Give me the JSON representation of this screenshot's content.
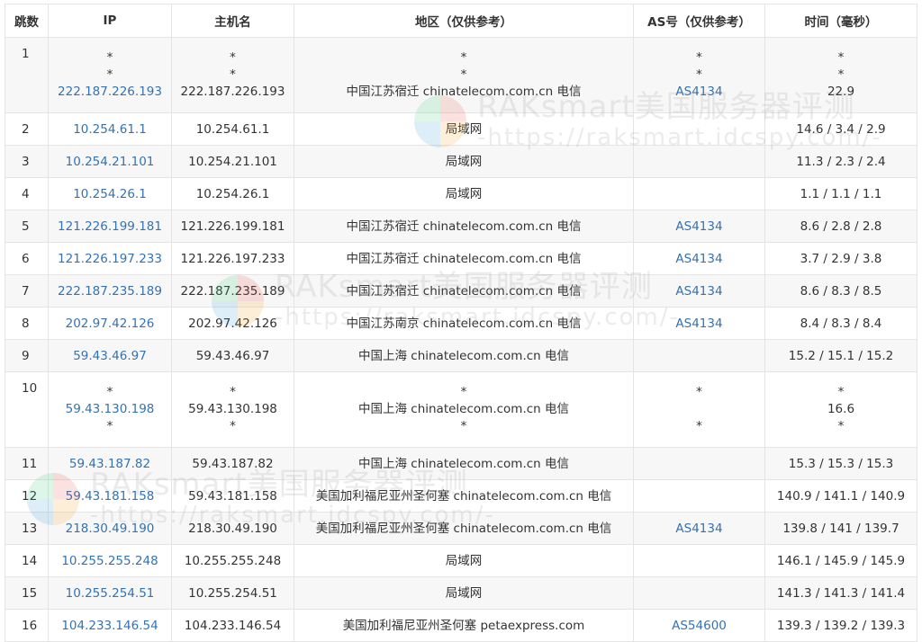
{
  "headers": [
    "跳数",
    "IP",
    "主机名",
    "地区（仅供参考）",
    "AS号（仅供参考）",
    "时间（毫秒）"
  ],
  "rows": [
    {
      "hop": "1",
      "ip": [
        "*",
        "*",
        "222.187.226.193"
      ],
      "host": [
        "*",
        "*",
        "222.187.226.193"
      ],
      "region": [
        "*",
        "*",
        "中国江苏宿迁 chinatelecom.com.cn 电信"
      ],
      "as": [
        "*",
        "*",
        "AS4134"
      ],
      "time": [
        "*",
        "*",
        "22.9"
      ]
    },
    {
      "hop": "2",
      "ip": [
        "10.254.61.1"
      ],
      "host": [
        "10.254.61.1"
      ],
      "region": [
        "局域网"
      ],
      "as": [
        ""
      ],
      "time": [
        "14.6 / 3.4 / 2.9"
      ]
    },
    {
      "hop": "3",
      "ip": [
        "10.254.21.101"
      ],
      "host": [
        "10.254.21.101"
      ],
      "region": [
        "局域网"
      ],
      "as": [
        ""
      ],
      "time": [
        "11.3 / 2.3 / 2.4"
      ]
    },
    {
      "hop": "4",
      "ip": [
        "10.254.26.1"
      ],
      "host": [
        "10.254.26.1"
      ],
      "region": [
        "局域网"
      ],
      "as": [
        ""
      ],
      "time": [
        "1.1 / 1.1 / 1.1"
      ]
    },
    {
      "hop": "5",
      "ip": [
        "121.226.199.181"
      ],
      "host": [
        "121.226.199.181"
      ],
      "region": [
        "中国江苏宿迁 chinatelecom.com.cn 电信"
      ],
      "as": [
        "AS4134"
      ],
      "time": [
        "8.6 / 2.8 / 2.8"
      ]
    },
    {
      "hop": "6",
      "ip": [
        "121.226.197.233"
      ],
      "host": [
        "121.226.197.233"
      ],
      "region": [
        "中国江苏宿迁 chinatelecom.com.cn 电信"
      ],
      "as": [
        "AS4134"
      ],
      "time": [
        "3.7 / 2.9 / 3.8"
      ]
    },
    {
      "hop": "7",
      "ip": [
        "222.187.235.189"
      ],
      "host": [
        "222.187.235.189"
      ],
      "region": [
        "中国江苏宿迁 chinatelecom.com.cn 电信"
      ],
      "as": [
        "AS4134"
      ],
      "time": [
        "8.6 / 8.3 / 8.5"
      ]
    },
    {
      "hop": "8",
      "ip": [
        "202.97.42.126"
      ],
      "host": [
        "202.97.42.126"
      ],
      "region": [
        "中国江苏南京 chinatelecom.com.cn 电信"
      ],
      "as": [
        "AS4134"
      ],
      "time": [
        "8.4 / 8.3 / 8.4"
      ]
    },
    {
      "hop": "9",
      "ip": [
        "59.43.46.97"
      ],
      "host": [
        "59.43.46.97"
      ],
      "region": [
        "中国上海 chinatelecom.com.cn 电信"
      ],
      "as": [
        ""
      ],
      "time": [
        "15.2 / 15.1 / 15.2"
      ]
    },
    {
      "hop": "10",
      "ip": [
        "*",
        "59.43.130.198",
        "*"
      ],
      "host": [
        "*",
        "59.43.130.198",
        "*"
      ],
      "region": [
        "*",
        "中国上海 chinatelecom.com.cn 电信",
        "*"
      ],
      "as": [
        "*",
        "",
        "*"
      ],
      "time": [
        "*",
        "16.6",
        "*"
      ]
    },
    {
      "hop": "11",
      "ip": [
        "59.43.187.82"
      ],
      "host": [
        "59.43.187.82"
      ],
      "region": [
        "中国上海 chinatelecom.com.cn 电信"
      ],
      "as": [
        ""
      ],
      "time": [
        "15.3 / 15.3 / 15.3"
      ]
    },
    {
      "hop": "12",
      "ip": [
        "59.43.181.158"
      ],
      "host": [
        "59.43.181.158"
      ],
      "region": [
        "美国加利福尼亚州圣何塞 chinatelecom.com.cn 电信"
      ],
      "as": [
        ""
      ],
      "time": [
        "140.9 / 141.1 / 140.9"
      ]
    },
    {
      "hop": "13",
      "ip": [
        "218.30.49.190"
      ],
      "host": [
        "218.30.49.190"
      ],
      "region": [
        "美国加利福尼亚州圣何塞 chinatelecom.com.cn 电信"
      ],
      "as": [
        "AS4134"
      ],
      "time": [
        "139.8 / 141 / 139.7"
      ]
    },
    {
      "hop": "14",
      "ip": [
        "10.255.255.248"
      ],
      "host": [
        "10.255.255.248"
      ],
      "region": [
        "局域网"
      ],
      "as": [
        ""
      ],
      "time": [
        "146.1 / 145.9 / 145.9"
      ]
    },
    {
      "hop": "15",
      "ip": [
        "10.255.254.51"
      ],
      "host": [
        "10.255.254.51"
      ],
      "region": [
        "局域网"
      ],
      "as": [
        ""
      ],
      "time": [
        "141.3 / 141.3 / 141.4"
      ]
    },
    {
      "hop": "16",
      "ip": [
        "104.233.146.54"
      ],
      "host": [
        "104.233.146.54"
      ],
      "region": [
        "美国加利福尼亚州圣何塞 petaexpress.com"
      ],
      "as": [
        "AS54600"
      ],
      "time": [
        "139.3 / 139.2 / 139.3"
      ]
    }
  ],
  "watermark": {
    "title": "RAKsmart美国服务器评测",
    "url": "-https://raksmart.idcspy.com/-"
  },
  "colors": {
    "link": "#3572b0",
    "row_alt": "#f7f7f7",
    "border": "#e4e4e4"
  }
}
